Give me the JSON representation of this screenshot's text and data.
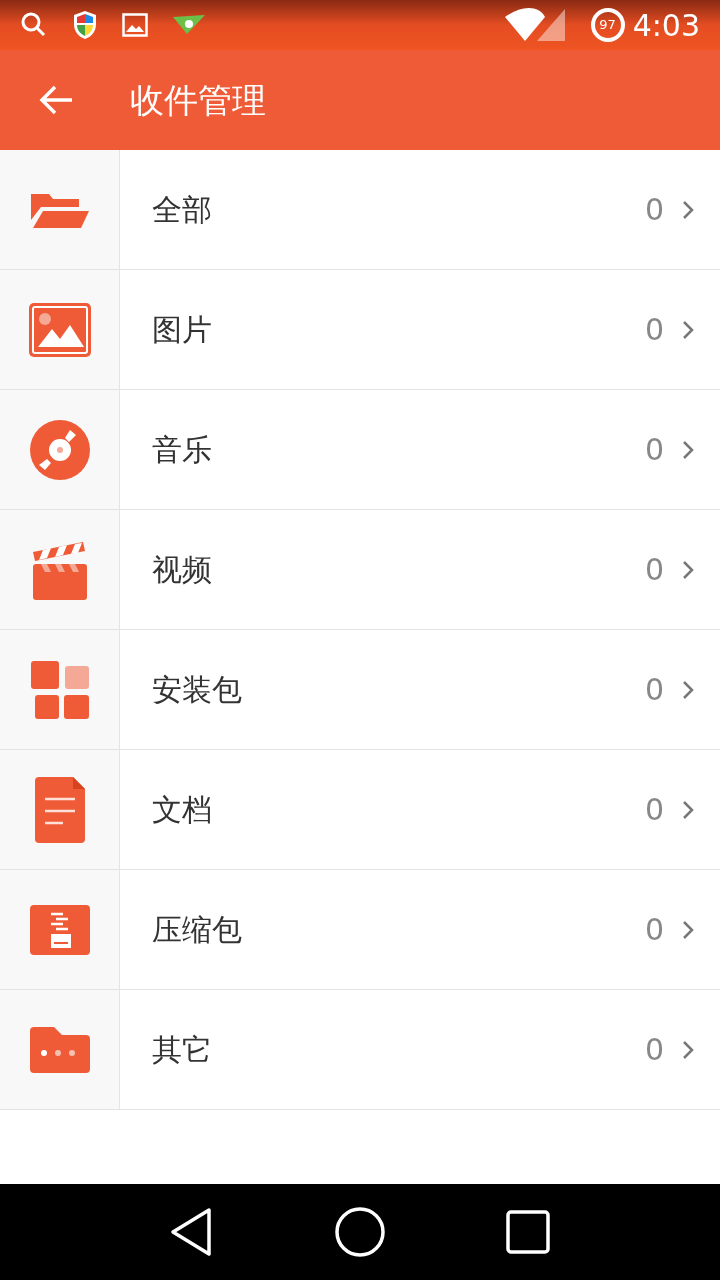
{
  "status_bar": {
    "battery": "97",
    "time": "4:03"
  },
  "app_bar": {
    "title": "收件管理"
  },
  "categories": [
    {
      "kind": "folder",
      "label": "全部",
      "count": "0"
    },
    {
      "kind": "image",
      "label": "图片",
      "count": "0"
    },
    {
      "kind": "disc",
      "label": "音乐",
      "count": "0"
    },
    {
      "kind": "clapper",
      "label": "视频",
      "count": "0"
    },
    {
      "kind": "apps",
      "label": "安装包",
      "count": "0"
    },
    {
      "kind": "document",
      "label": "文档",
      "count": "0"
    },
    {
      "kind": "archive",
      "label": "压缩包",
      "count": "0"
    },
    {
      "kind": "other",
      "label": "其它",
      "count": "0"
    }
  ]
}
